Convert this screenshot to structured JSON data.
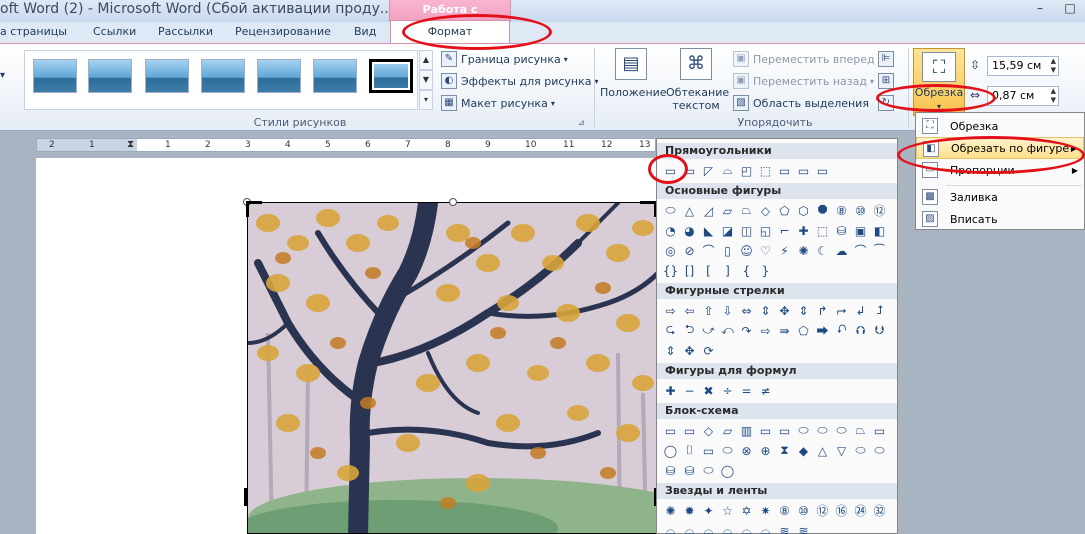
{
  "window": {
    "title": "oft Word (2) - Microsoft Word (Сбой активации проду...",
    "contextual_group": "Работа с рисунками",
    "controls": {
      "minimize": "–",
      "maximize": "□"
    }
  },
  "tabs": {
    "items": [
      "а страницы",
      "Ссылки",
      "Рассылки",
      "Рецензирование",
      "Вид"
    ],
    "active": "Формат"
  },
  "ribbon": {
    "styles_group": {
      "label": "Стили рисунков",
      "border": "Граница рисунка",
      "effects": "Эффекты для рисунка",
      "layout": "Макет рисунка"
    },
    "arrange_group": {
      "label": "Упорядочить",
      "position": "Положение",
      "wrap": "Обтекание текстом",
      "forward": "Переместить вперед",
      "backward": "Переместить назад",
      "selection": "Область выделения"
    },
    "size_group": {
      "crop": "Обрезка",
      "height": "15,59 см",
      "width": "0,87 см"
    }
  },
  "ruler": {
    "ticks": [
      "2",
      "1",
      "1",
      "2",
      "3",
      "4",
      "5",
      "6",
      "7",
      "8",
      "9",
      "10",
      "11",
      "12",
      "13"
    ]
  },
  "shapes_panel": {
    "sections": [
      {
        "title": "Прямоугольники",
        "rows": [
          [
            "▭",
            "▭",
            "◸",
            "⌓",
            "◰",
            "⬚",
            "▭",
            "▭",
            "▭"
          ]
        ]
      },
      {
        "title": "Основные фигуры",
        "rows": [
          [
            "⬭",
            "△",
            "◿",
            "▱",
            "⏢",
            "◇",
            "⬠",
            "⬡",
            "⯃",
            "⑧",
            "⑩",
            "⑫"
          ],
          [
            "◔",
            "◕",
            "◣",
            "◪",
            "◫",
            "◱",
            "⌐",
            "✚",
            "⬚",
            "⛁",
            "▣",
            "◧"
          ],
          [
            "◎",
            "⊘",
            "⌒",
            "▯",
            "☺",
            "♡",
            "⚡",
            "✺",
            "☾",
            "☁",
            "⌒",
            "⁀"
          ],
          [
            "{}",
            "[]",
            "[",
            "]",
            "{",
            "}"
          ]
        ]
      },
      {
        "title": "Фигурные стрелки",
        "rows": [
          [
            "⇨",
            "⇦",
            "⇧",
            "⇩",
            "⇔",
            "⇕",
            "✥",
            "⇕",
            "↱",
            "⮣",
            "↲",
            "⮥"
          ],
          [
            "⮎",
            "⮌",
            "⤻",
            "⤺",
            "↷",
            "⇨",
            "⇛",
            "⬠",
            "⮕",
            "⮏",
            "⮉",
            "⮋"
          ],
          [
            "⇕",
            "✥",
            "⟳"
          ]
        ]
      },
      {
        "title": "Фигуры для формул",
        "rows": [
          [
            "✚",
            "−",
            "✖",
            "÷",
            "=",
            "≠"
          ]
        ]
      },
      {
        "title": "Блок-схема",
        "rows": [
          [
            "▭",
            "▭",
            "◇",
            "▱",
            "▥",
            "▭",
            "▭",
            "⬭",
            "⬭",
            "⬭",
            "⏢",
            "▭"
          ],
          [
            "◯",
            "⌷",
            "▭",
            "⬭",
            "⊗",
            "⊕",
            "⧗",
            "◆",
            "△",
            "▽",
            "⬭",
            "⬭"
          ],
          [
            "⛁",
            "⛁",
            "⬭",
            "◯"
          ]
        ]
      },
      {
        "title": "Звезды и ленты",
        "rows": [
          [
            "✺",
            "✹",
            "✦",
            "☆",
            "✡",
            "✷",
            "⑧",
            "⑩",
            "⑫",
            "⑯",
            "㉔",
            "㉜"
          ],
          [
            "⌓",
            "⌓",
            "⌓",
            "⌓",
            "⌓",
            "⌓",
            "≋",
            "≋"
          ]
        ]
      }
    ]
  },
  "crop_menu": {
    "items": [
      {
        "label": "Обрезка",
        "icon": "crop-icon"
      },
      {
        "label": "Обрезать по фигуре",
        "icon": "shape-crop-icon",
        "has_submenu": true
      },
      {
        "label": "Пропорции",
        "icon": "aspect-icon",
        "has_submenu": true
      },
      {
        "label": "Заливка",
        "icon": "fill-icon"
      },
      {
        "label": "Вписать",
        "icon": "fit-icon"
      }
    ]
  },
  "colors": {
    "context_tab": "#f2a3c2",
    "annotation": "#e3101a",
    "highlight": "#ffe08a"
  }
}
